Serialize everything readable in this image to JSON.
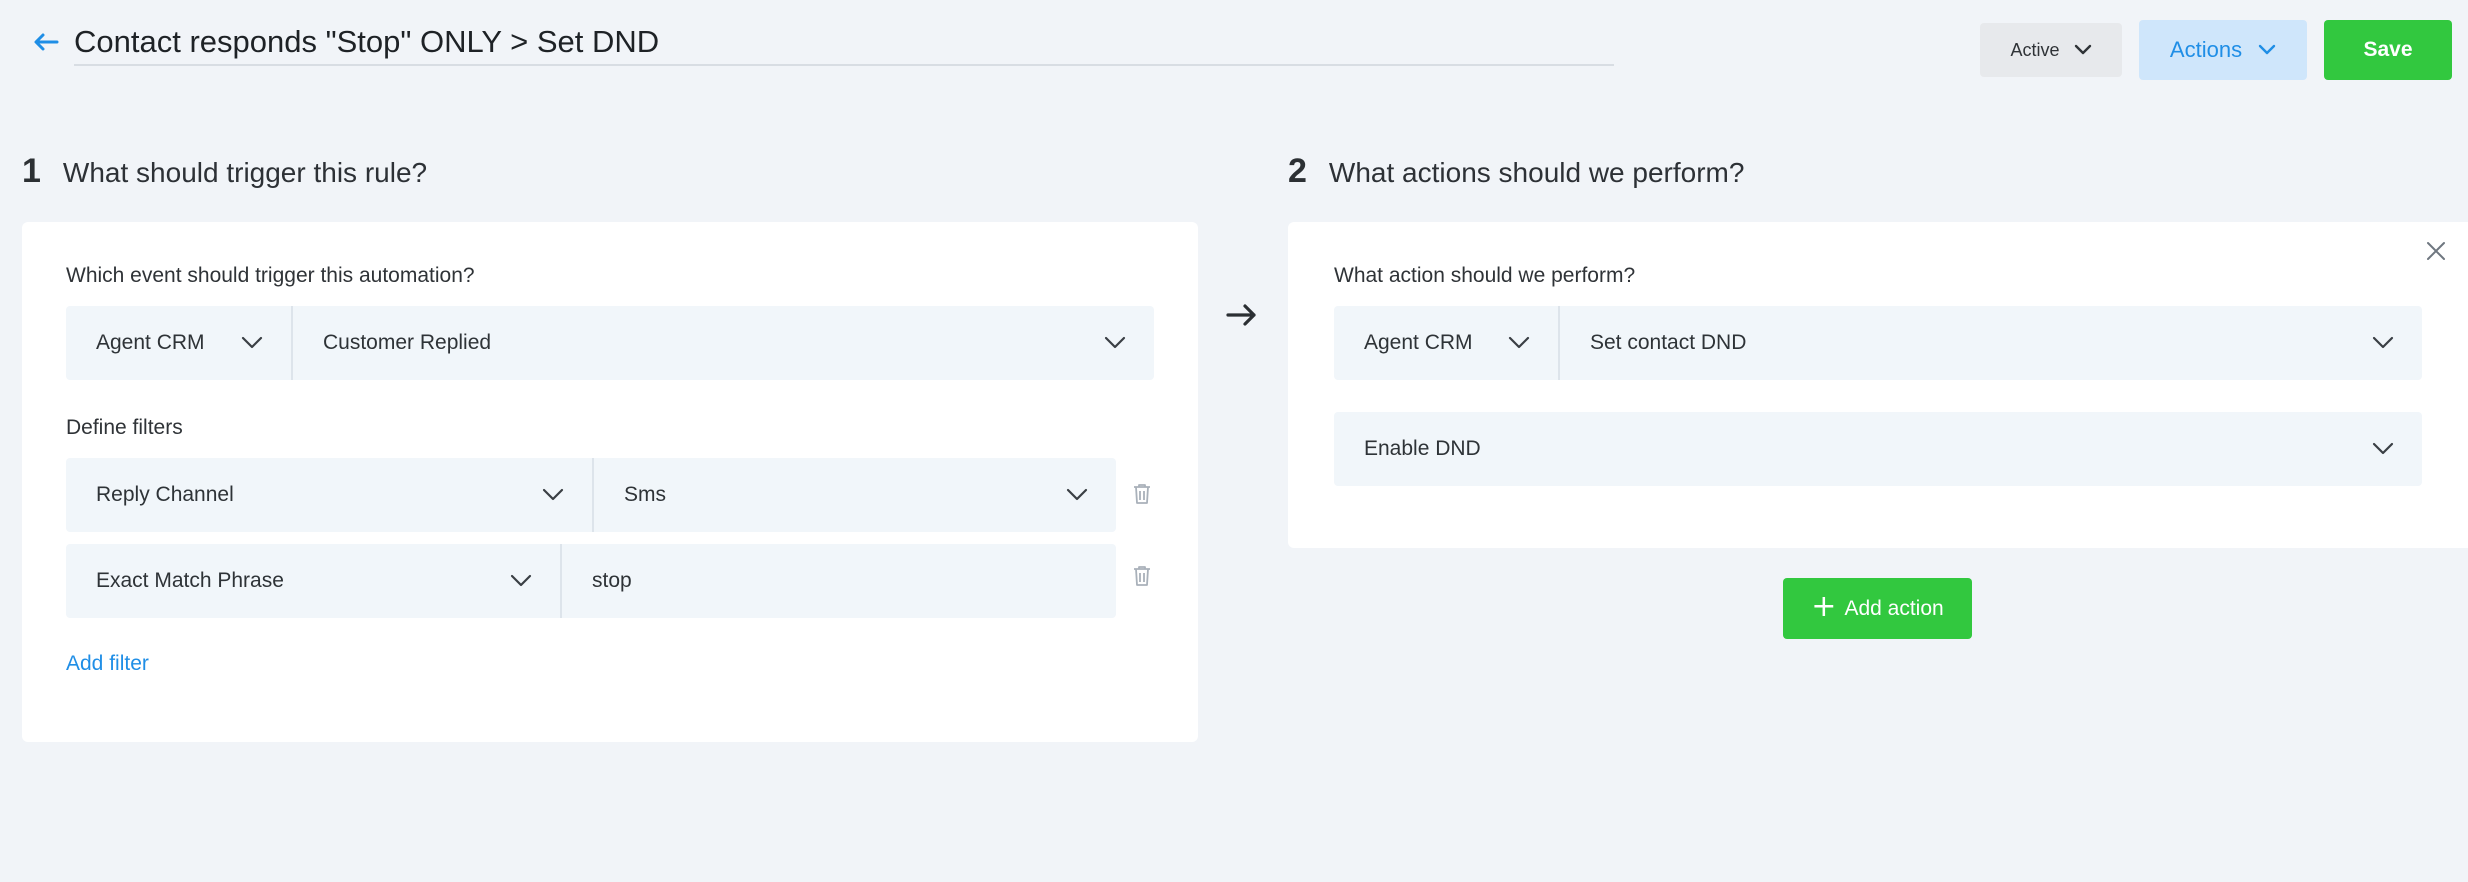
{
  "header": {
    "title": "Contact responds \"Stop\" ONLY > Set DND",
    "status_label": "Active",
    "actions_label": "Actions",
    "save_label": "Save"
  },
  "trigger_section": {
    "number": "1",
    "heading": "What should trigger this rule?",
    "event_label": "Which event should trigger this automation?",
    "event_source": "Agent CRM",
    "event_type": "Customer Replied",
    "filters_label": "Define filters",
    "filters": [
      {
        "field": "Reply Channel",
        "value": "Sms"
      },
      {
        "field": "Exact Match Phrase",
        "value": "stop"
      }
    ],
    "add_filter_label": "Add filter"
  },
  "action_section": {
    "number": "2",
    "heading": "What actions should we perform?",
    "action_label": "What action should we perform?",
    "action_source": "Agent CRM",
    "action_type": "Set contact DND",
    "option_value": "Enable DND",
    "add_action_label": "Add action"
  },
  "icons": {
    "back": "arrow-left-icon",
    "chevron": "chevron-down-icon",
    "delete": "trash-icon",
    "connector": "arrow-right-icon",
    "close": "close-icon",
    "add": "plus-icon"
  },
  "colors": {
    "accent_blue": "#1f8ee6",
    "brand_green": "#32c83f",
    "page_background": "#f1f4f8",
    "field_background": "#f1f6fa"
  }
}
